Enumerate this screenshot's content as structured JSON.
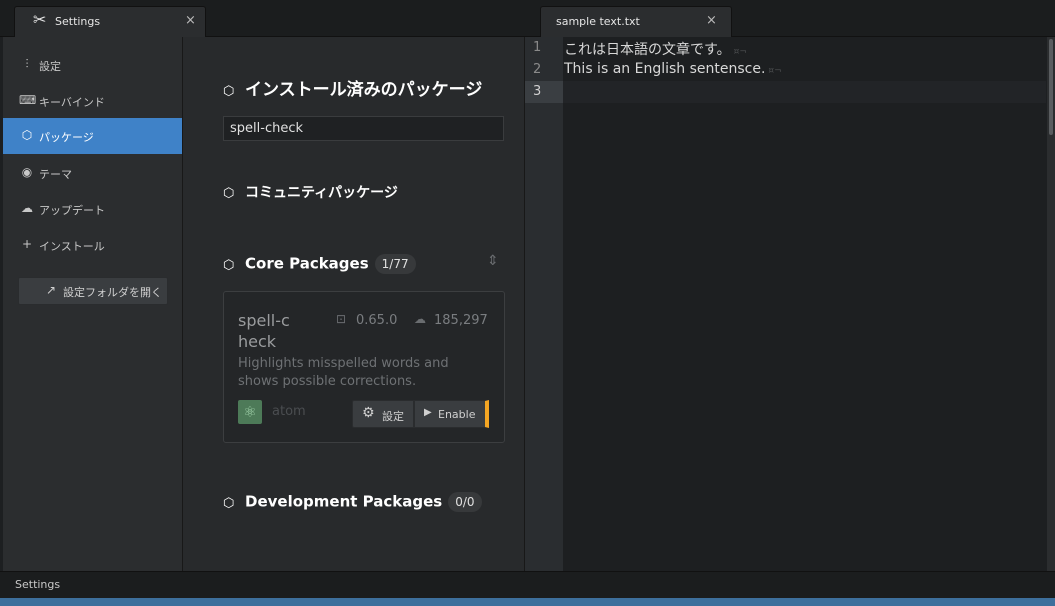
{
  "tabs": [
    {
      "label": "Settings",
      "close": "×"
    },
    {
      "label": "sample text.txt",
      "close": "×"
    }
  ],
  "sidebar": {
    "items": [
      {
        "label": "設定",
        "icon": "sliders-icon"
      },
      {
        "label": "キーバインド",
        "icon": "keyboard-icon"
      },
      {
        "label": "パッケージ",
        "icon": "package-icon"
      },
      {
        "label": "テーマ",
        "icon": "paintcan-icon"
      },
      {
        "label": "アップデート",
        "icon": "cloud-download-icon"
      },
      {
        "label": "インストール",
        "icon": "plus-icon"
      }
    ],
    "open_folder_label": "設定フォルダを開く"
  },
  "main": {
    "installed_heading": "インストール済みのパッケージ",
    "filter_value": "spell-check",
    "community_heading": "コミュニティパッケージ",
    "core_heading": "Core Packages",
    "core_count": "1/77",
    "dev_heading": "Development Packages",
    "dev_count": "0/0",
    "card": {
      "name": "spell-check",
      "version": "0.65.0",
      "downloads": "185,297",
      "description": "Highlights misspelled words and shows possible corrections.",
      "author": "atom",
      "settings_label": "設定",
      "enable_label": "Enable"
    }
  },
  "editor": {
    "line_numbers": [
      "1",
      "2",
      "3"
    ],
    "lines": [
      "これは日本語の文章です。",
      "This is an English sentensce."
    ],
    "invisible_marker": "¤¬"
  },
  "status": {
    "text": "Settings"
  },
  "colors": {
    "accent": "#3f82c8",
    "orange": "#f5a623"
  }
}
